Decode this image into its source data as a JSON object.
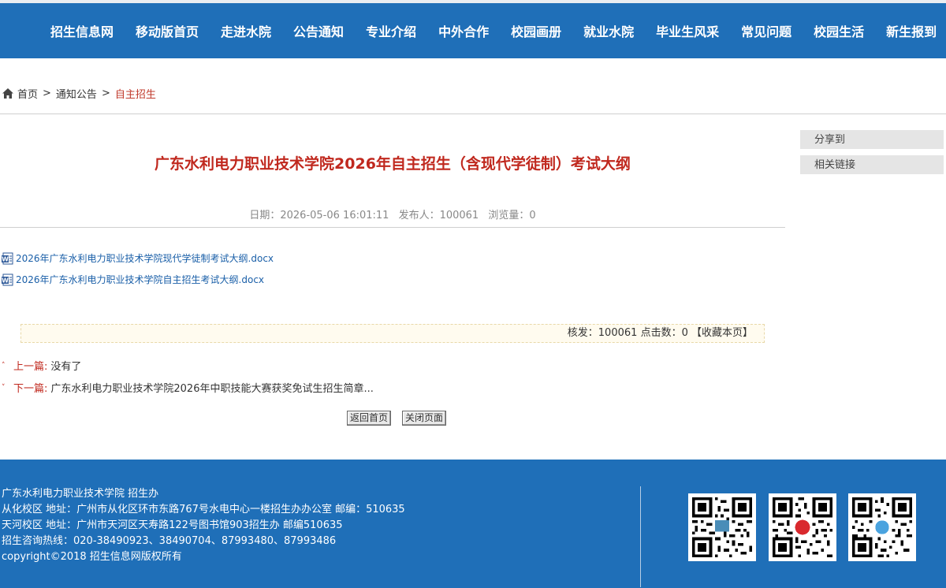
{
  "nav": {
    "items": [
      "招生信息网",
      "移动版首页",
      "走进水院",
      "公告通知",
      "专业介绍",
      "中外合作",
      "校园画册",
      "就业水院",
      "毕业生风采",
      "常见问题",
      "校园生活",
      "新生报到"
    ]
  },
  "breadcrumb": {
    "home": "首页",
    "sep1": ">",
    "section": "通知公告",
    "sep2": ">",
    "current": "自主招生"
  },
  "sidebar": {
    "share": "分享到",
    "links": "相关链接"
  },
  "article": {
    "title": "广东水利电力职业技术学院2026年自主招生（含现代学徒制）考试大纲",
    "date_label": "日期：2026-05-06 16:01:11",
    "publisher_label": "发布人：100061",
    "views_label": "浏览量：0",
    "attachments": [
      "2026年广东水利电力职业技术学院现代学徒制考试大纲.docx",
      "2026年广东水利电力职业技术学院自主招生考试大纲.docx"
    ],
    "info": {
      "approver": "核发：100061",
      "clicks": "点击数：0",
      "favorite": "【收藏本页】"
    },
    "prev_label": "上一篇:",
    "prev_text": "没有了",
    "next_label": "下一篇:",
    "next_text": "广东水利电力职业技术学院2026年中职技能大赛获奖免试生招生简章...",
    "btn_home": "返回首页",
    "btn_close": "关闭页面"
  },
  "footer": {
    "line1": "广东水利电力职业技术学院 招生办",
    "line2": "从化校区 地址：广州市从化区环市东路767号水电中心一楼招生办办公室 邮编：510635",
    "line3": "天河校区 地址：广州市天河区天寿路122号图书馆903招生办 邮编510635",
    "line4": "招生咨询热线：020-38490923、38490704、87993480、87993486",
    "line5": "copyright©2018 招生信息网版权所有"
  },
  "colors": {
    "brand_blue": "#1f6fb8",
    "accent_red": "#c0281e"
  },
  "icons": {
    "home": "home-icon",
    "doc": "word-doc-icon",
    "qr": "qr-code-icon"
  }
}
